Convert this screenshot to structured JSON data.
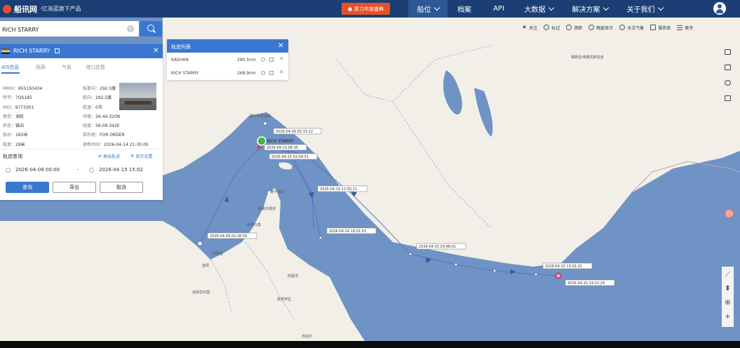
{
  "nav": {
    "brand": "船讯网",
    "brand_sub": "·亿海蓝旗下产品",
    "promo": "算力年度盛典",
    "items": [
      {
        "label": "船位",
        "dropdown": true
      },
      {
        "label": "档案",
        "dropdown": false
      },
      {
        "label": "API",
        "dropdown": false
      },
      {
        "label": "大数据",
        "dropdown": true
      },
      {
        "label": "解决方案",
        "dropdown": true
      },
      {
        "label": "关于我们",
        "dropdown": true
      }
    ]
  },
  "search": {
    "value": "RICH STARRY",
    "clear": "×"
  },
  "map_tools": [
    "关注",
    "标记",
    "测距",
    "图层显示",
    "水文气象",
    "服务商",
    "更多"
  ],
  "ship_panel": {
    "name": "RICH STARRY",
    "tabs": [
      "AIS信息",
      "档案",
      "气象",
      "港口挂靠"
    ],
    "info_left": [
      {
        "k": "MMSI：",
        "v": "655150434"
      },
      {
        "k": "呼号：",
        "v": "7QS185"
      },
      {
        "k": "IMO：",
        "v": "9773301"
      },
      {
        "k": "类型：",
        "v": "油轮"
      },
      {
        "k": "状态：",
        "v": "锚泊"
      },
      {
        "k": "船长：",
        "v": "183米"
      },
      {
        "k": "船宽：",
        "v": "28米"
      }
    ],
    "info_right": [
      {
        "k": "船首向：",
        "v": "292.0度"
      },
      {
        "k": "航向：",
        "v": "292.5度"
      },
      {
        "k": "航速：",
        "v": "0节"
      },
      {
        "k": "纬度：",
        "v": "26-44.320N"
      },
      {
        "k": "经度：",
        "v": "56-09.342E"
      },
      {
        "k": "目的地：",
        "v": "FOR ORDER"
      },
      {
        "k": "更新时间：",
        "v": "2026-04-14 21:30:00"
      }
    ],
    "track_label": "轨迹查询",
    "link_similar": "类似轨迹",
    "link_settings": "显示设置",
    "date_from": "2026-04-08 00:00",
    "date_sep": "-",
    "date_to": "2026-04-15 15:02",
    "btn_query": "查询",
    "btn_export": "导出",
    "btn_cancel": "取消"
  },
  "track_list": {
    "title": "轨迹列表",
    "rows": [
      {
        "name": "KASHAN",
        "dist": "280.5nm"
      },
      {
        "name": "RICH STARRY",
        "dist": "268.9nm"
      }
    ]
  },
  "map": {
    "ship_label": "RICH STARRY",
    "track_labels": [
      "2026-04-09 05:15:12",
      "2026-04-13 06:35",
      "2026-04-15 02:04:51",
      "2026-04-14 12:55:11",
      "2026-04-14 18:01:03",
      "2026-04-09 02:28:59",
      "2026-04-15 03:48:01",
      "2026-04-15 13:01:21",
      "2026-04-15 14:22:24"
    ],
    "place_labels": [
      "霍尔木兹海峡",
      "锡斯坦-俾路支斯坦省",
      "格什姆岛",
      "穆桑代姆省",
      "哈伊马角",
      "阿联酋",
      "迪拜",
      "阿曼湾",
      "富查伊拉",
      "迪拜酋长国",
      "苏哈尔"
    ]
  },
  "colors": {
    "nav_bg": "#1b3f74",
    "accent": "#3a77d0",
    "track": "#5a6fbf",
    "sea": "#6e93c4",
    "land": "#f1efe8",
    "promo": "#e8502b"
  }
}
